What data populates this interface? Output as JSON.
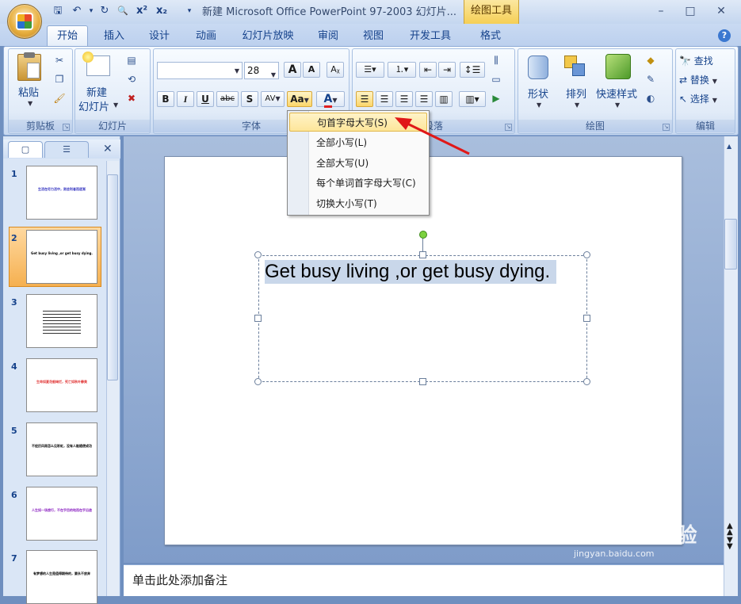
{
  "window": {
    "title": "新建 Microsoft Office PowerPoint 97-2003 幻灯片...",
    "context_tools": "绘图工具",
    "minimize": "–",
    "maximize": "□",
    "close": "✕"
  },
  "qat": {
    "save": "🖫",
    "undo": "↶",
    "redo": "↻",
    "preview": "🔍",
    "superscript": "x²",
    "subscript": "x₂",
    "more": "▾"
  },
  "tabs": [
    "开始",
    "插入",
    "设计",
    "动画",
    "幻灯片放映",
    "审阅",
    "视图",
    "开发工具",
    "格式"
  ],
  "help": "?",
  "ribbon": {
    "clipboard": {
      "label": "剪贴板",
      "paste": "粘贴"
    },
    "slides": {
      "label": "幻灯片",
      "new_slide_line1": "新建",
      "new_slide_line2": "幻灯片"
    },
    "font": {
      "label": "字体",
      "font_name": "",
      "font_size": "28",
      "grow": "A",
      "shrink": "A",
      "bold": "B",
      "italic": "I",
      "underline": "U",
      "strike": "abc",
      "shadow": "S",
      "spacing": "AV",
      "case": "Aa",
      "color": "A"
    },
    "paragraph": {
      "label": "段落"
    },
    "drawing": {
      "label": "绘图",
      "shapes": "形状",
      "arrange": "排列",
      "quick_styles": "快速样式"
    },
    "editing": {
      "label": "编辑",
      "find": "查找",
      "replace": "替换",
      "select": "选择"
    }
  },
  "case_menu": {
    "items": [
      {
        "label": "句首字母大写(S)",
        "highlighted": true
      },
      {
        "label": "全部小写(L)",
        "highlighted": false
      },
      {
        "label": "全部大写(U)",
        "highlighted": false
      },
      {
        "label": "每个单词首字母大写(C)",
        "highlighted": false
      },
      {
        "label": "切换大小写(T)",
        "highlighted": false
      }
    ]
  },
  "slides_panel": {
    "tab_slides": "▢",
    "tab_outline": "☰",
    "close": "✕",
    "thumbnails": [
      {
        "num": "1",
        "text": "生活在尽力活中，则会利者而逐渐",
        "color": "#3030c0"
      },
      {
        "num": "2",
        "text": "Get busy living ,or get busy dying.",
        "color": "#000000"
      },
      {
        "num": "3",
        "text": "",
        "color": "#000000"
      },
      {
        "num": "4",
        "text": "生命如夏花般绚烂，死亡如秋叶静美",
        "color": "#e03030"
      },
      {
        "num": "5",
        "text": "不经历风雨怎么见彩虹，没有人能随便成功",
        "color": "#000000"
      },
      {
        "num": "6",
        "text": "人生如一场旅行，不在乎目的地而在乎沿途",
        "color": "#8a20c0"
      },
      {
        "num": "7",
        "text": "有梦想的人生是值得期待的，要永不放弃",
        "color": "#000000"
      }
    ],
    "selected": 2
  },
  "slide": {
    "text": "Get busy living ,or get busy dying."
  },
  "notes": {
    "placeholder": "单击此处添加备注"
  },
  "watermark": {
    "brand": "Bai du 经验",
    "url": "jingyan.baidu.com"
  }
}
